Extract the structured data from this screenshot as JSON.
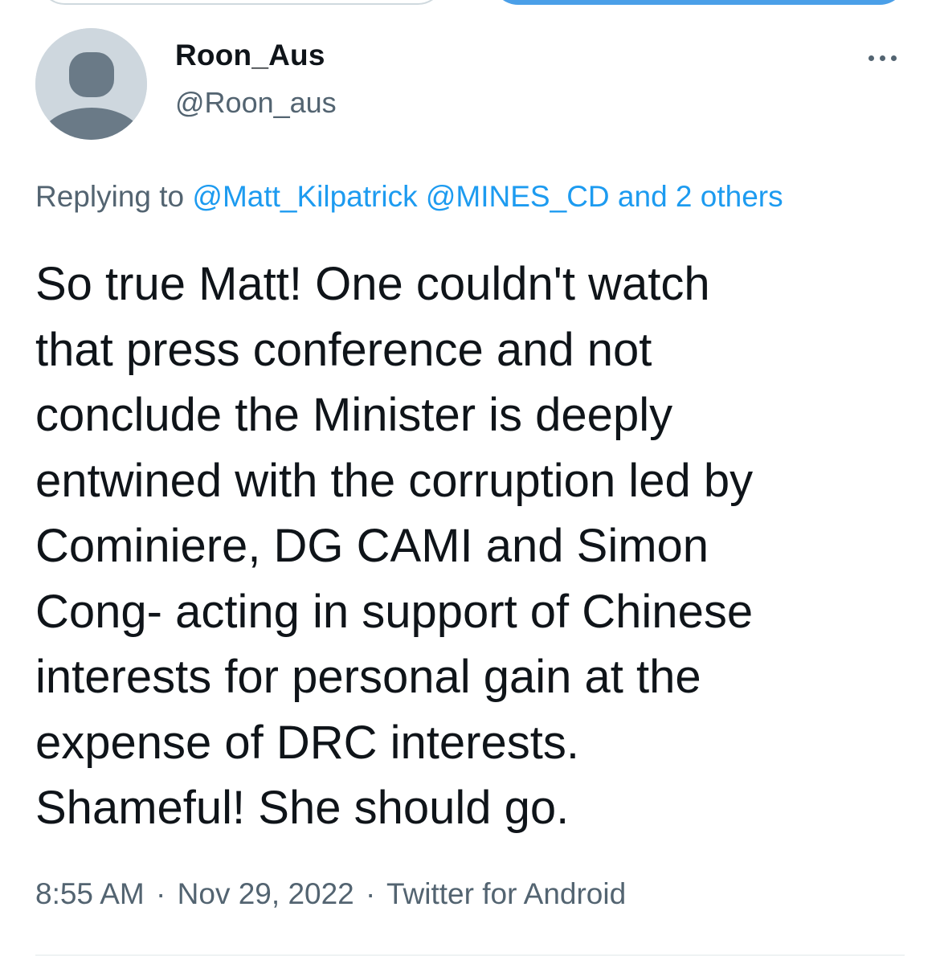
{
  "author": {
    "display_name": "Roon_Aus",
    "handle": "@Roon_aus"
  },
  "reply": {
    "prefix": "Replying to",
    "mentions": [
      "@Matt_Kilpatrick",
      "@MINES_CD"
    ],
    "others": "and 2 others"
  },
  "tweet": {
    "lines": [
      "So true Matt! One couldn't watch",
      "that press conference and not",
      "conclude the Minister is deeply",
      "entwined with the corruption led by",
      "Cominiere, DG CAMI and Simon",
      "Cong- acting in support of Chinese",
      "interests for personal gain at the",
      "expense of DRC interests.",
      "Shameful! She should go."
    ]
  },
  "meta": {
    "time": "8:55 AM",
    "separator": "·",
    "date": "Nov 29, 2022",
    "source": "Twitter for Android"
  },
  "icons": {
    "avatar": "default-avatar-icon",
    "more": "more-options-icon"
  },
  "colors": {
    "text": "#0f1419",
    "secondary": "#536471",
    "link": "#1d9bf0",
    "avatar_bg": "#ced7de",
    "avatar_fg": "#6a7a87"
  }
}
